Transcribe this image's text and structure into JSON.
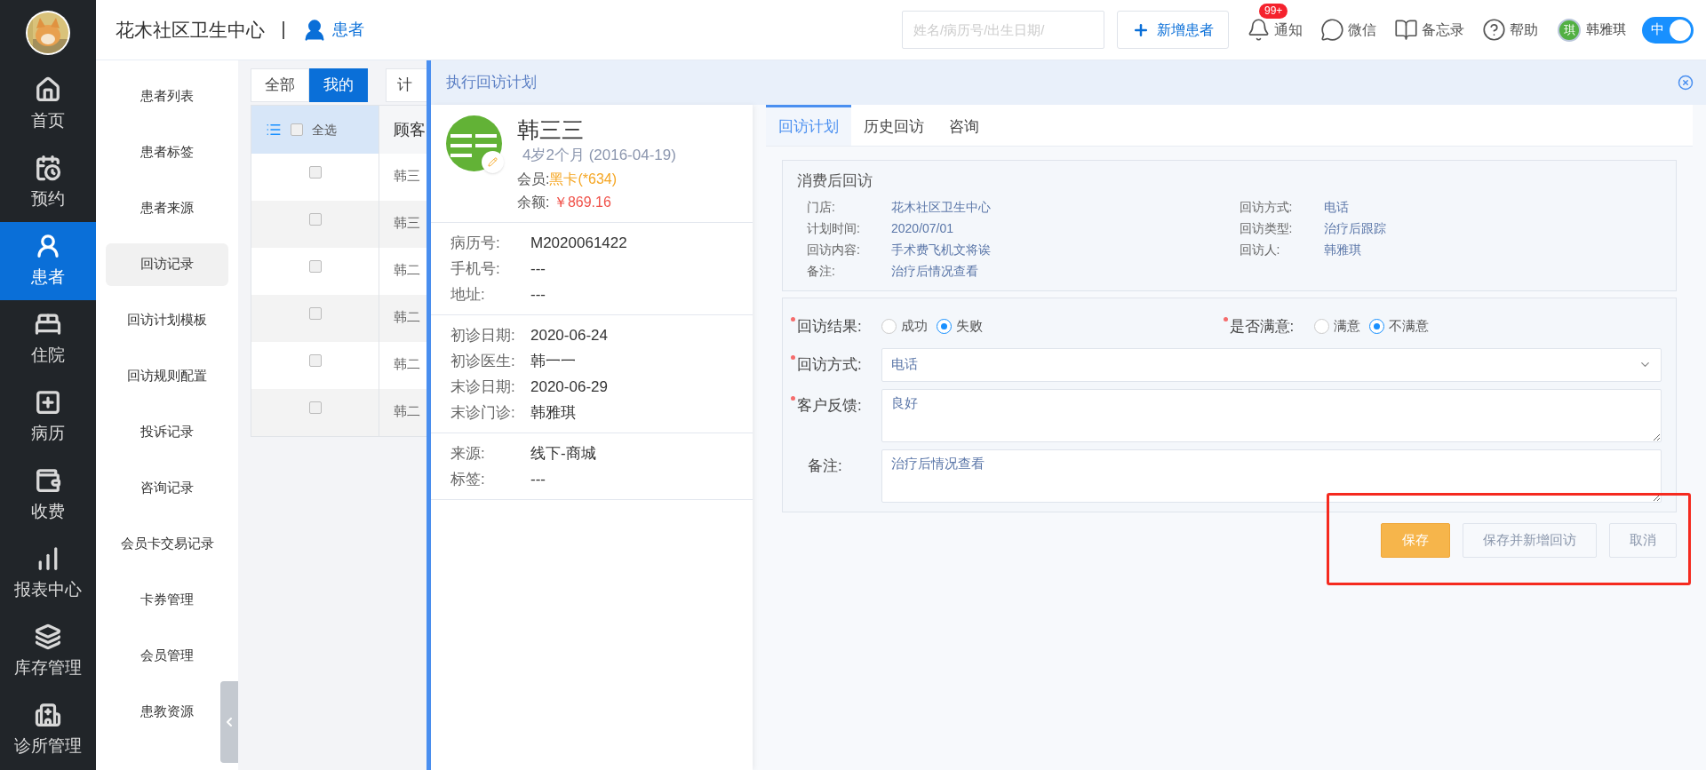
{
  "nav": [
    {
      "label": "首页",
      "selected": false
    },
    {
      "label": "预约",
      "selected": false
    },
    {
      "label": "患者",
      "selected": true
    },
    {
      "label": "住院",
      "selected": false
    },
    {
      "label": "病历",
      "selected": false
    },
    {
      "label": "收费",
      "selected": false
    },
    {
      "label": "报表中心",
      "selected": false
    },
    {
      "label": "库存管理",
      "selected": false
    },
    {
      "label": "诊所管理",
      "selected": false
    }
  ],
  "header": {
    "clinic": "花木社区卫生中心",
    "module": "患者",
    "search": {
      "placeholder": "姓名/病历号/出生日期/"
    },
    "add_button": "新增患者",
    "tools": [
      {
        "label": "通知",
        "badge": "99+"
      },
      {
        "label": "微信"
      },
      {
        "label": "备忘录"
      },
      {
        "label": "帮助"
      }
    ],
    "user": {
      "avatar": "琪",
      "name": "韩雅琪"
    },
    "lang_toggle": {
      "label": "中",
      "on": true
    }
  },
  "submenu": [
    {
      "label": "患者列表",
      "selected": false
    },
    {
      "label": "患者标签",
      "selected": false
    },
    {
      "label": "患者来源",
      "selected": false
    },
    {
      "label": "回访记录",
      "selected": true
    },
    {
      "label": "回访计划模板",
      "selected": false
    },
    {
      "label": "回访规则配置",
      "selected": false
    },
    {
      "label": "投诉记录",
      "selected": false
    },
    {
      "label": "咨询记录",
      "selected": false
    },
    {
      "label": "会员卡交易记录",
      "selected": false
    },
    {
      "label": "卡券管理",
      "selected": false
    },
    {
      "label": "会员管理",
      "selected": false
    },
    {
      "label": "患教资源",
      "selected": false
    }
  ],
  "filter_tabs": [
    {
      "label": "全部",
      "selected": false
    },
    {
      "label": "我的",
      "selected": true
    }
  ],
  "plan_filter": "计",
  "table": {
    "select_all": {
      "label": "全选",
      "checked": false
    },
    "columns": [
      "顾客"
    ],
    "rows": [
      {
        "checked": false,
        "name": "韩三"
      },
      {
        "checked": false,
        "name": "韩三"
      },
      {
        "checked": false,
        "name": "韩二"
      },
      {
        "checked": false,
        "name": "韩二"
      },
      {
        "checked": false,
        "name": "韩二"
      },
      {
        "checked": false,
        "name": "韩二"
      }
    ]
  },
  "modal": {
    "title": "执行回访计划",
    "patient": {
      "name": "韩三三",
      "age": "4岁2个月 (2016-04-19)",
      "member_label": "会员:",
      "member_card": "黑卡(*634)",
      "balance_label": "余额:",
      "balance": "￥869.16",
      "groups": [
        [
          {
            "label": "病历号:",
            "value": "M2020061422"
          },
          {
            "label": "手机号:",
            "value": "---"
          },
          {
            "label": "地址:",
            "value": "---"
          }
        ],
        [
          {
            "label": "初诊日期:",
            "value": "2020-06-24"
          },
          {
            "label": "初诊医生:",
            "value": "韩一一"
          },
          {
            "label": "末诊日期:",
            "value": "2020-06-29"
          },
          {
            "label": "末诊门诊:",
            "value": "韩雅琪"
          }
        ],
        [
          {
            "label": "来源:",
            "value": "线下-商城"
          },
          {
            "label": "标签:",
            "value": "---"
          }
        ]
      ]
    },
    "tabs": [
      {
        "label": "回访计划",
        "selected": true
      },
      {
        "label": "历史回访",
        "selected": false
      },
      {
        "label": "咨询",
        "selected": false
      }
    ],
    "plan": {
      "title": "消费后回访",
      "left": [
        {
          "label": "门店:",
          "value": "花木社区卫生中心"
        },
        {
          "label": "计划时间:",
          "value": "2020/07/01"
        },
        {
          "label": "回访内容:",
          "value": "手术费飞机文将诶"
        },
        {
          "label": "备注:",
          "value": "治疗后情况查看"
        }
      ],
      "right": [
        {
          "label": "回访方式:",
          "value": "电话"
        },
        {
          "label": "回访类型:",
          "value": "治疗后跟踪"
        },
        {
          "label": "回访人:",
          "value": "韩雅琪"
        }
      ]
    },
    "form": {
      "radios": [
        {
          "label": "回访结果:",
          "required": true,
          "options": [
            {
              "label": "成功",
              "selected": false
            },
            {
              "label": "失败",
              "selected": true
            }
          ]
        },
        {
          "label": "是否满意:",
          "required": true,
          "options": [
            {
              "label": "满意",
              "selected": false
            },
            {
              "label": "不满意",
              "selected": true
            }
          ]
        }
      ],
      "fields": [
        {
          "kind": "select",
          "label": "回访方式:",
          "required": true,
          "value": "电话"
        },
        {
          "kind": "textarea",
          "label": "客户反馈:",
          "required": true,
          "value": "良好"
        },
        {
          "kind": "textarea",
          "label": "备注:",
          "required": false,
          "value": "治疗后情况查看"
        }
      ]
    },
    "buttons": [
      {
        "label": "保存",
        "kind": "primary"
      },
      {
        "label": "保存并新增回访",
        "kind": "default"
      },
      {
        "label": "取消",
        "kind": "default"
      }
    ]
  }
}
